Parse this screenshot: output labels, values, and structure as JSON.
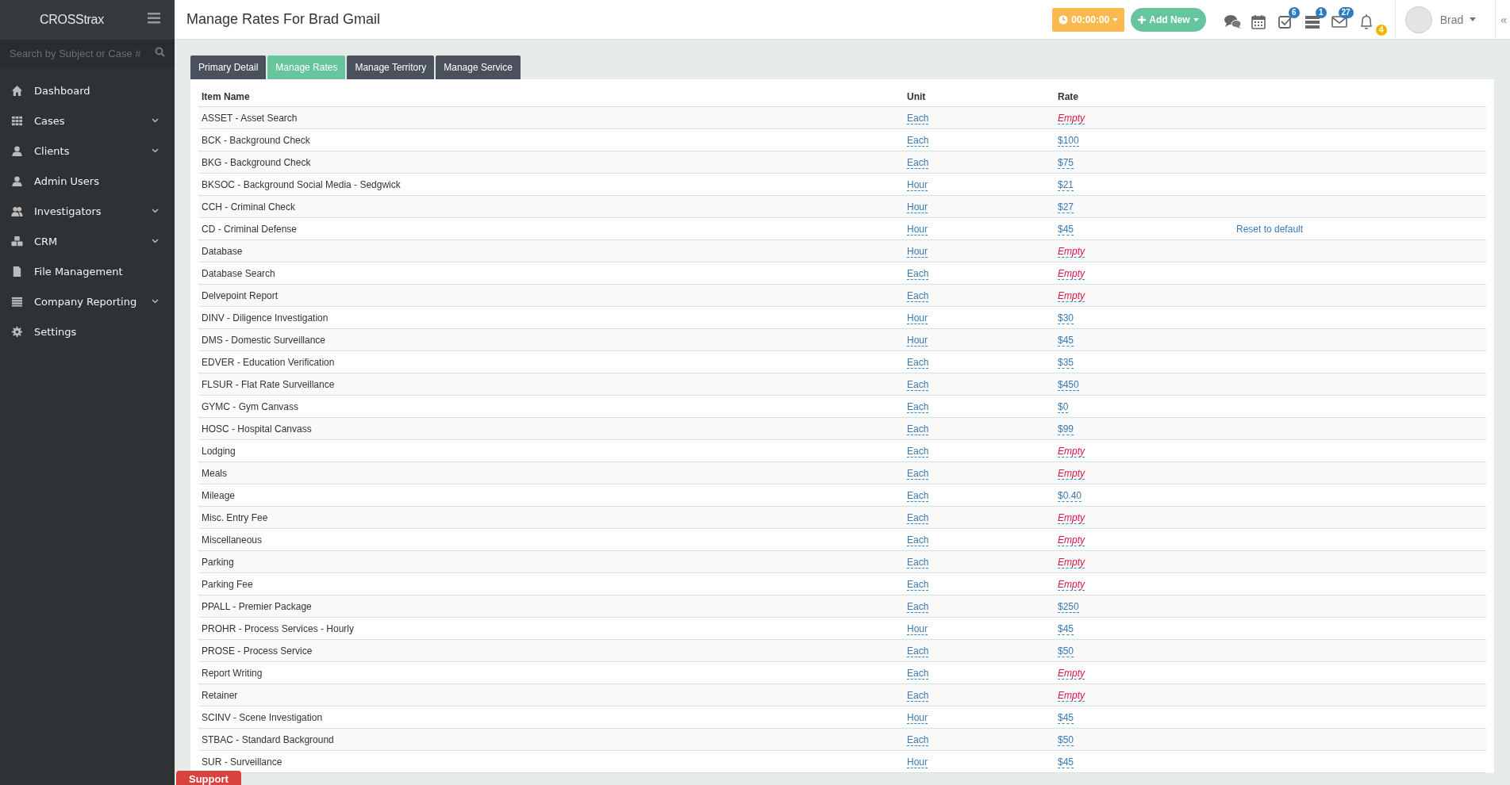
{
  "sidebar": {
    "brand": "CROSStrax",
    "search": {
      "placeholder": "Search by Subject or Case #"
    },
    "items": [
      {
        "label": "Dashboard",
        "kind": "home",
        "expandable": false
      },
      {
        "label": "Cases",
        "kind": "grid",
        "expandable": true
      },
      {
        "label": "Clients",
        "kind": "person",
        "expandable": true
      },
      {
        "label": "Admin Users",
        "kind": "person",
        "expandable": false
      },
      {
        "label": "Investigators",
        "kind": "people",
        "expandable": true
      },
      {
        "label": "CRM",
        "kind": "cubes",
        "expandable": true
      },
      {
        "label": "File Management",
        "kind": "file",
        "expandable": false
      },
      {
        "label": "Company Reporting",
        "kind": "list",
        "expandable": true
      },
      {
        "label": "Settings",
        "kind": "gear",
        "expandable": false
      }
    ]
  },
  "header": {
    "title": "Manage Rates For Brad Gmail",
    "timer": "00:00:00",
    "add_new": "Add New",
    "icons": [
      {
        "kind": "chat"
      },
      {
        "kind": "calendar"
      },
      {
        "kind": "tasks",
        "badge": "6"
      },
      {
        "kind": "stack",
        "badge": "1"
      },
      {
        "kind": "mail",
        "badge": "27"
      },
      {
        "kind": "bell",
        "badge": "4"
      }
    ],
    "user": "Brad",
    "collapse": "«"
  },
  "tabs": [
    {
      "label": "Primary Detail",
      "selected": false
    },
    {
      "label": "Manage Rates",
      "selected": true
    },
    {
      "label": "Manage Territory",
      "selected": false
    },
    {
      "label": "Manage Service",
      "selected": false
    }
  ],
  "table": {
    "columns": [
      "Item Name",
      "Unit",
      "Rate"
    ],
    "rows": [
      {
        "name": "ASSET - Asset Search",
        "unit": "Each",
        "rate": "Empty",
        "empty": true
      },
      {
        "name": "BCK - Background Check",
        "unit": "Each",
        "rate": "$100",
        "empty": false
      },
      {
        "name": "BKG - Background Check",
        "unit": "Each",
        "rate": "$75",
        "empty": false
      },
      {
        "name": "BKSOC - Background Social Media - Sedgwick",
        "unit": "Hour",
        "rate": "$21",
        "empty": false
      },
      {
        "name": "CCH - Criminal Check",
        "unit": "Hour",
        "rate": "$27",
        "empty": false
      },
      {
        "name": "CD - Criminal Defense",
        "unit": "Hour",
        "rate": "$45",
        "empty": false,
        "reset": "Reset to default"
      },
      {
        "name": "Database",
        "unit": "Hour",
        "rate": "Empty",
        "empty": true
      },
      {
        "name": "Database Search",
        "unit": "Each",
        "rate": "Empty",
        "empty": true
      },
      {
        "name": "Delvepoint Report",
        "unit": "Each",
        "rate": "Empty",
        "empty": true
      },
      {
        "name": "DINV - Diligence Investigation",
        "unit": "Hour",
        "rate": "$30",
        "empty": false
      },
      {
        "name": "DMS - Domestic Surveillance",
        "unit": "Hour",
        "rate": "$45",
        "empty": false
      },
      {
        "name": "EDVER - Education Verification",
        "unit": "Each",
        "rate": "$35",
        "empty": false
      },
      {
        "name": "FLSUR - Flat Rate Surveillance",
        "unit": "Each",
        "rate": "$450",
        "empty": false
      },
      {
        "name": "GYMC - Gym Canvass",
        "unit": "Each",
        "rate": "$0",
        "empty": false
      },
      {
        "name": "HOSC - Hospital Canvass",
        "unit": "Each",
        "rate": "$99",
        "empty": false
      },
      {
        "name": "Lodging",
        "unit": "Each",
        "rate": "Empty",
        "empty": true
      },
      {
        "name": "Meals",
        "unit": "Each",
        "rate": "Empty",
        "empty": true
      },
      {
        "name": "Mileage",
        "unit": "Each",
        "rate": "$0.40",
        "empty": false
      },
      {
        "name": "Misc. Entry Fee",
        "unit": "Each",
        "rate": "Empty",
        "empty": true
      },
      {
        "name": "Miscellaneous",
        "unit": "Each",
        "rate": "Empty",
        "empty": true
      },
      {
        "name": "Parking",
        "unit": "Each",
        "rate": "Empty",
        "empty": true
      },
      {
        "name": "Parking Fee",
        "unit": "Each",
        "rate": "Empty",
        "empty": true
      },
      {
        "name": "PPALL - Premier Package",
        "unit": "Each",
        "rate": "$250",
        "empty": false
      },
      {
        "name": "PROHR - Process Services - Hourly",
        "unit": "Hour",
        "rate": "$45",
        "empty": false
      },
      {
        "name": "PROSE - Process Service",
        "unit": "Each",
        "rate": "$50",
        "empty": false
      },
      {
        "name": "Report Writing",
        "unit": "Each",
        "rate": "Empty",
        "empty": true
      },
      {
        "name": "Retainer",
        "unit": "Each",
        "rate": "Empty",
        "empty": true
      },
      {
        "name": "SCINV - Scene Investigation",
        "unit": "Hour",
        "rate": "$45",
        "empty": false
      },
      {
        "name": "STBAC - Standard Background",
        "unit": "Each",
        "rate": "$50",
        "empty": false
      },
      {
        "name": "SUR - Surveillance",
        "unit": "Hour",
        "rate": "$45",
        "empty": false
      }
    ]
  },
  "support": "Support"
}
